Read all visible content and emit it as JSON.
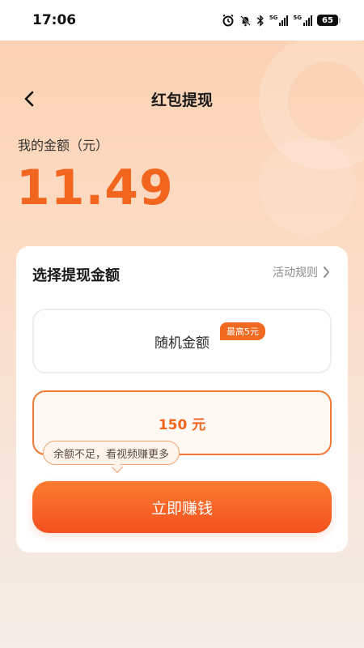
{
  "status_bar": {
    "time": "17:06",
    "signal1_label": "5G",
    "signal2_label": "5G",
    "battery": "65"
  },
  "nav": {
    "back_icon": "chevron-left-icon",
    "title": "红包提现"
  },
  "balance": {
    "label": "我的金额（元）",
    "amount": "11.49"
  },
  "card": {
    "title": "选择提现金额",
    "rules_label": "活动规则",
    "options": [
      {
        "label": "随机金额",
        "badge": "最高5元",
        "selected": false
      },
      {
        "label": "150 元",
        "selected": true
      }
    ],
    "tooltip": "余额不足，看视频赚更多",
    "cta_label": "立即赚钱"
  },
  "colors": {
    "accent": "#f2651e",
    "cta_start": "#fb7b2f",
    "cta_end": "#f4511f"
  }
}
